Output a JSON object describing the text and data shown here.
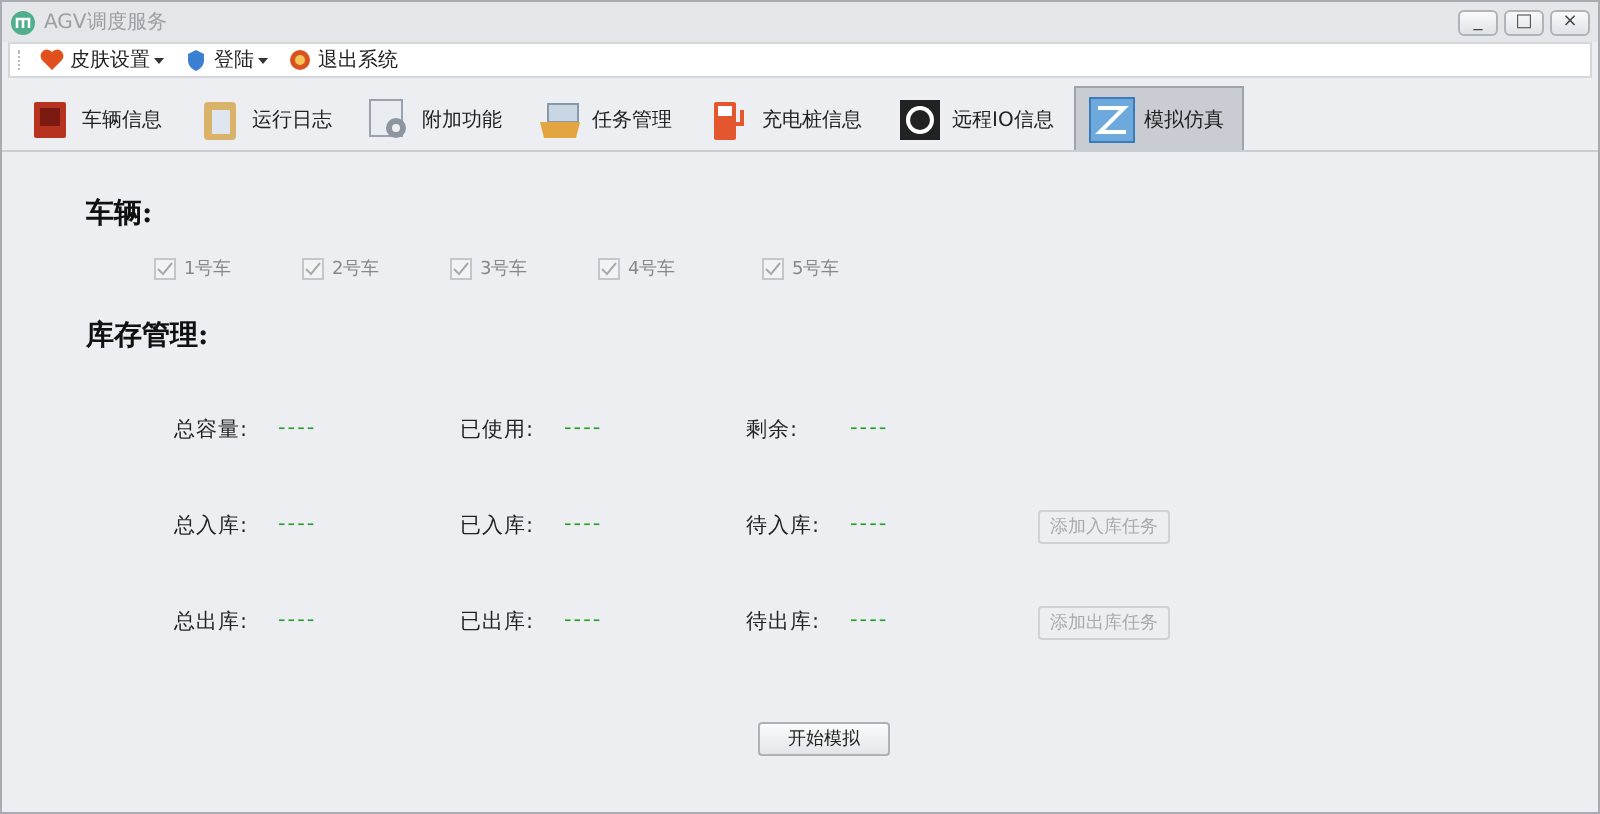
{
  "window": {
    "title": "AGV调度服务",
    "controls": [
      "_",
      "□",
      "×"
    ]
  },
  "menu": [
    {
      "label": "皮肤设置",
      "dropdown": true
    },
    {
      "label": "登陆",
      "dropdown": true
    },
    {
      "label": "退出系统",
      "dropdown": false
    }
  ],
  "tabs": [
    {
      "label": "车辆信息",
      "selected": false
    },
    {
      "label": "运行日志",
      "selected": false
    },
    {
      "label": "附加功能",
      "selected": false
    },
    {
      "label": "任务管理",
      "selected": false
    },
    {
      "label": "充电桩信息",
      "selected": false
    },
    {
      "label": "远程IO信息",
      "selected": false
    },
    {
      "label": "模拟仿真",
      "selected": true
    }
  ],
  "vehicles": {
    "heading": "车辆:",
    "items": [
      {
        "label": "1号车",
        "checked": true,
        "disabled": true
      },
      {
        "label": "2号车",
        "checked": true,
        "disabled": true
      },
      {
        "label": "3号车",
        "checked": true,
        "disabled": true
      },
      {
        "label": "4号车",
        "checked": true,
        "disabled": true
      },
      {
        "label": "5号车",
        "checked": true,
        "disabled": true
      }
    ]
  },
  "inventory": {
    "heading": "库存管理:",
    "rows": [
      {
        "stats": [
          {
            "label": "总容量:",
            "value": "----"
          },
          {
            "label": "已使用:",
            "value": "----"
          },
          {
            "label": "剩余:",
            "value": "----"
          }
        ]
      },
      {
        "stats": [
          {
            "label": "总入库:",
            "value": "----"
          },
          {
            "label": "已入库:",
            "value": "----"
          },
          {
            "label": "待入库:",
            "value": "----"
          }
        ],
        "button": {
          "label": "添加入库任务",
          "disabled": true
        }
      },
      {
        "stats": [
          {
            "label": "总出库:",
            "value": "----"
          },
          {
            "label": "已出库:",
            "value": "----"
          },
          {
            "label": "待出库:",
            "value": "----"
          }
        ],
        "button": {
          "label": "添加出库任务",
          "disabled": true
        }
      }
    ]
  },
  "start_button": {
    "label": "开始模拟",
    "disabled": false
  }
}
